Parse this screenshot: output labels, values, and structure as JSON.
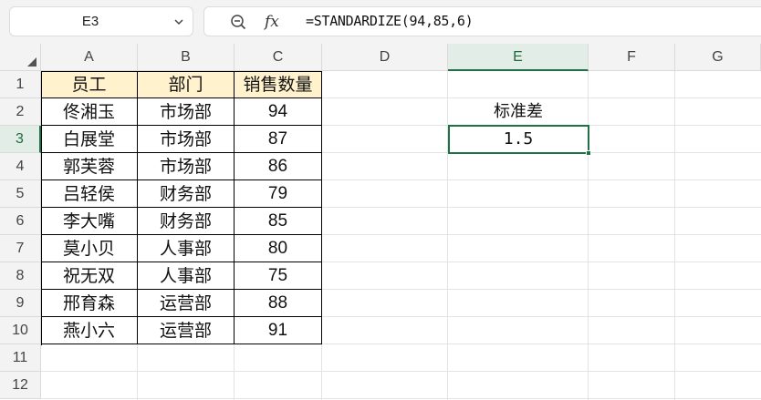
{
  "name_box": {
    "value": "E3",
    "icon": "chevron-down-icon"
  },
  "formula_bar": {
    "zoom_icon": "zoom-formula-icon",
    "fx_label": "fx",
    "formula": "=STANDARDIZE(94,85,6)"
  },
  "columns": [
    "A",
    "B",
    "C",
    "D",
    "E",
    "F",
    "G"
  ],
  "active_column": "E",
  "rows": [
    "1",
    "2",
    "3",
    "4",
    "5",
    "6",
    "7",
    "8",
    "9",
    "10",
    "11",
    "12"
  ],
  "active_row": "3",
  "table": {
    "headers": [
      "员工",
      "部门",
      "销售数量"
    ],
    "rows": [
      [
        "佟湘玉",
        "市场部",
        "94"
      ],
      [
        "白展堂",
        "市场部",
        "87"
      ],
      [
        "郭芙蓉",
        "市场部",
        "86"
      ],
      [
        "吕轻侯",
        "财务部",
        "79"
      ],
      [
        "李大嘴",
        "财务部",
        "85"
      ],
      [
        "莫小贝",
        "人事部",
        "80"
      ],
      [
        "祝无双",
        "人事部",
        "75"
      ],
      [
        "邢育森",
        "运营部",
        "88"
      ],
      [
        "燕小六",
        "运营部",
        "91"
      ]
    ]
  },
  "side": {
    "label": "标准差",
    "value": "1.5"
  },
  "colors": {
    "accent": "#1e7145",
    "header_fill": "#fff2cc"
  }
}
